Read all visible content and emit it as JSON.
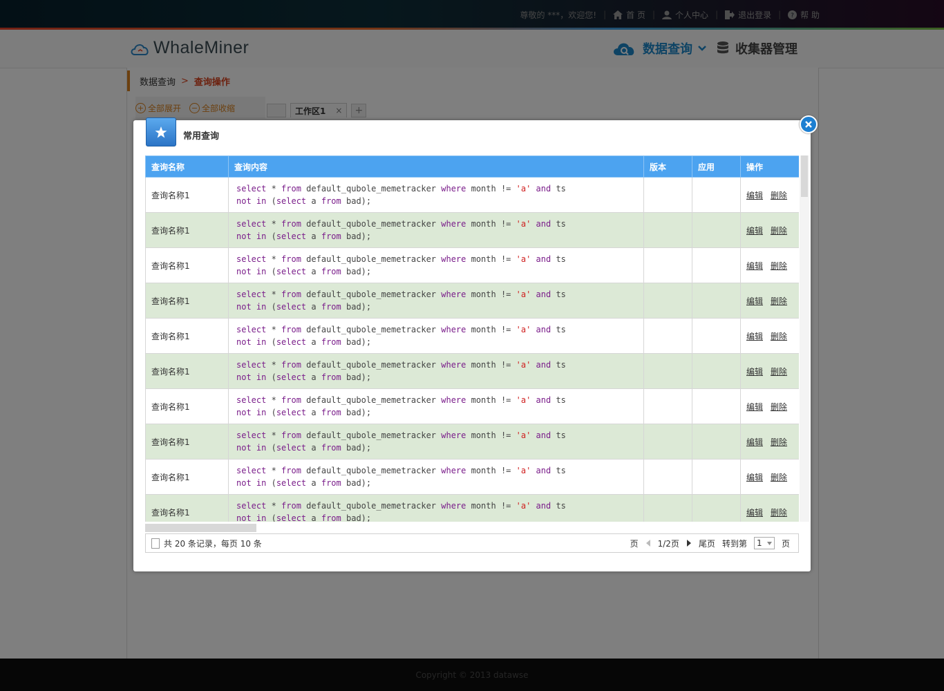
{
  "topnav": {
    "welcome": "尊敬的 ***，欢迎您!",
    "home": "首 页",
    "profile": "个人中心",
    "logout": "退出登录",
    "help": "帮 助"
  },
  "logo": {
    "text": "WhaleMiner"
  },
  "mainnav": {
    "query": "数据查询",
    "collector": "收集器管理"
  },
  "breadcrumb": {
    "parent": "数据查询",
    "arrow": ">",
    "current": "查询操作"
  },
  "leftpanel": {
    "expand": "全部展开",
    "collapse": "全部收缩"
  },
  "tabs": {
    "workspace": "工作区1",
    "close": "×",
    "add": "+"
  },
  "footer": {
    "copyright": "Copyright © 2013 datawse"
  },
  "modal": {
    "title": "常用查询",
    "columns": [
      "查询名称",
      "查询内容",
      "版本",
      "应用",
      "操作"
    ],
    "rows": [
      {
        "name": "查询名称1",
        "version": "",
        "app": "",
        "edit": "编辑",
        "delete": "删除"
      },
      {
        "name": "查询名称1",
        "version": "",
        "app": "",
        "edit": "编辑",
        "delete": "删除"
      },
      {
        "name": "查询名称1",
        "version": "",
        "app": "",
        "edit": "编辑",
        "delete": "删除"
      },
      {
        "name": "查询名称1",
        "version": "",
        "app": "",
        "edit": "编辑",
        "delete": "删除"
      },
      {
        "name": "查询名称1",
        "version": "",
        "app": "",
        "edit": "编辑",
        "delete": "删除"
      },
      {
        "name": "查询名称1",
        "version": "",
        "app": "",
        "edit": "编辑",
        "delete": "删除"
      },
      {
        "name": "查询名称1",
        "version": "",
        "app": "",
        "edit": "编辑",
        "delete": "删除"
      },
      {
        "name": "查询名称1",
        "version": "",
        "app": "",
        "edit": "编辑",
        "delete": "删除"
      },
      {
        "name": "查询名称1",
        "version": "",
        "app": "",
        "edit": "编辑",
        "delete": "删除"
      },
      {
        "name": "查询名称1",
        "version": "",
        "app": "",
        "edit": "编辑",
        "delete": "删除"
      }
    ],
    "sql_tokens": [
      {
        "t": "select",
        "c": "kw"
      },
      {
        "t": " * ",
        "c": ""
      },
      {
        "t": "from",
        "c": "kw"
      },
      {
        "t": " default_qubole_memetracker ",
        "c": ""
      },
      {
        "t": "where",
        "c": "kw"
      },
      {
        "t": " month != ",
        "c": ""
      },
      {
        "t": "'a'",
        "c": "str"
      },
      {
        "t": " ",
        "c": ""
      },
      {
        "t": "and",
        "c": "kw"
      },
      {
        "t": " ts",
        "c": ""
      },
      {
        "t": "\n",
        "c": ""
      },
      {
        "t": "not in",
        "c": "kw"
      },
      {
        "t": " (",
        "c": ""
      },
      {
        "t": "select",
        "c": "kw"
      },
      {
        "t": " a ",
        "c": ""
      },
      {
        "t": "from",
        "c": "kw"
      },
      {
        "t": " bad);",
        "c": ""
      }
    ],
    "pager": {
      "summary": "共 20 条记录，每页 10 条",
      "page_label": "页",
      "current": "1/2页",
      "last": "尾页",
      "goto": "转到第",
      "goto_value": "1",
      "goto_suffix": "页"
    }
  },
  "colors": {
    "header_blue": "#4ca3f0",
    "alt_row": "#dce9d6",
    "accent_orange": "#d9811f",
    "keyword": "#7a1d8a",
    "string": "#d02020"
  }
}
